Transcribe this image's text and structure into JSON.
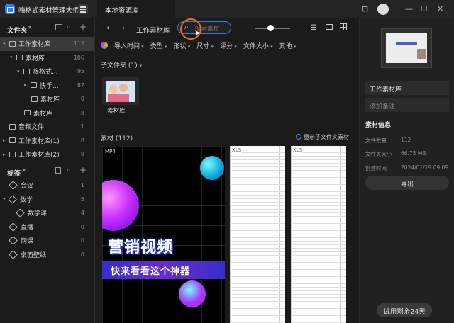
{
  "app": {
    "title": "嗨格式素材管理大师",
    "tab": "本地资源库"
  },
  "window_controls": [
    "⊡",
    "—",
    "☐",
    "✕"
  ],
  "sidebar": {
    "folders_header": "文件夹",
    "folders": [
      {
        "label": "工作素材库",
        "count": "112"
      },
      {
        "label": "素材库",
        "count": "106"
      },
      {
        "label": "嗨格式...",
        "count": "95"
      },
      {
        "label": "快手...",
        "count": "87"
      },
      {
        "label": "素材库",
        "count": "8"
      },
      {
        "label": "素材库",
        "count": "8"
      },
      {
        "label": "音频文件",
        "count": "1"
      },
      {
        "label": "工作素材库(1)",
        "count": "8"
      },
      {
        "label": "工作素材库(2)",
        "count": "8"
      }
    ],
    "tags_header": "标签",
    "tags": [
      {
        "label": "会议",
        "count": "1"
      },
      {
        "label": "数学",
        "count": "5"
      },
      {
        "label": "数学课",
        "count": "4"
      },
      {
        "label": "直播",
        "count": "0"
      },
      {
        "label": "网课",
        "count": "0"
      },
      {
        "label": "桌面壁纸",
        "count": "0"
      }
    ]
  },
  "toolbar": {
    "breadcrumb": "工作素材库",
    "search_placeholder": "搜索素材"
  },
  "filters": [
    "导入时间",
    "类型",
    "形状",
    "尺寸",
    "评分",
    "文件大小",
    "其他"
  ],
  "subfolders": {
    "header": "子文件夹 (1)",
    "items": [
      {
        "label": "素材库"
      }
    ]
  },
  "assets": {
    "header": "素材 (112)",
    "show_subfolder": "显示子文件夹素材",
    "video": {
      "format": "MP4",
      "title": "营销视频",
      "subtitle": "快来看看这个神器"
    },
    "xls_tag": "XLS"
  },
  "right_panel": {
    "name": "工作素材库",
    "note_placeholder": "添加备注",
    "info_header": "素材信息",
    "info": [
      {
        "key": "文件数量",
        "value": "112"
      },
      {
        "key": "文件夹大小",
        "value": "66.75 MB"
      },
      {
        "key": "创建时间",
        "value": "2024/01/19 09:09"
      }
    ],
    "export_label": "导出",
    "trial_label": "试用剩余24天"
  }
}
